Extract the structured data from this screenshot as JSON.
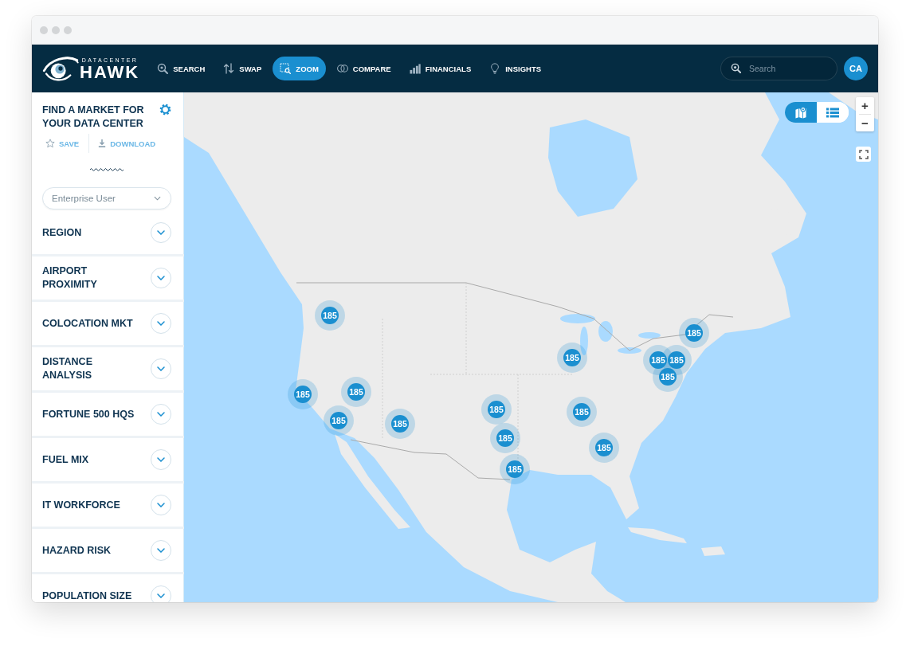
{
  "header": {
    "logo": {
      "line_1": "DATACENTER",
      "line_2": "HAWK"
    },
    "nav": [
      {
        "kind": "search",
        "label": "SEARCH",
        "selected": false
      },
      {
        "kind": "swap",
        "label": "SWAP",
        "selected": false
      },
      {
        "kind": "zoom",
        "label": "ZOOM",
        "selected": true
      },
      {
        "kind": "compare",
        "label": "COMPARE",
        "selected": false
      },
      {
        "kind": "financials",
        "label": "FINANCIALS",
        "selected": false
      },
      {
        "kind": "insights",
        "label": "INSIGHTS",
        "selected": false
      }
    ],
    "search": {
      "placeholder": "Search"
    },
    "avatar": {
      "initials": "CA"
    }
  },
  "sidebar": {
    "title": "FIND A MARKET FOR YOUR DATA CENTER",
    "actions": [
      {
        "kind": "save",
        "label": "SAVE"
      },
      {
        "kind": "download",
        "label": "DOWNLOAD"
      }
    ],
    "user_type": {
      "value": "Enterprise User"
    },
    "filters": [
      {
        "label": "REGION",
        "expanded": false
      },
      {
        "label": "AIRPORT PROXIMITY",
        "expanded": false
      },
      {
        "label": "COLOCATION MKT",
        "expanded": false
      },
      {
        "label": "DISTANCE ANALYSIS",
        "expanded": false
      },
      {
        "label": "FORTUNE 500 HQS",
        "expanded": false
      },
      {
        "label": "FUEL MIX",
        "expanded": false
      },
      {
        "label": "IT WORKFORCE",
        "expanded": false
      },
      {
        "label": "HAZARD RISK",
        "expanded": false
      },
      {
        "label": "POPULATION SIZE",
        "expanded": false
      }
    ]
  },
  "map": {
    "view_toggle": [
      {
        "kind": "map",
        "selected": true
      },
      {
        "kind": "list",
        "selected": false
      }
    ],
    "zoom_controls": [
      "+",
      "−"
    ],
    "clusters": [
      {
        "count": "185"
      },
      {
        "count": "185"
      },
      {
        "count": "185"
      },
      {
        "count": "185"
      },
      {
        "count": "185"
      },
      {
        "count": "185"
      },
      {
        "count": "185"
      },
      {
        "count": "185"
      },
      {
        "count": "185"
      },
      {
        "count": "185"
      },
      {
        "count": "185"
      },
      {
        "count": "185"
      },
      {
        "count": "185"
      },
      {
        "count": "185"
      },
      {
        "count": "185"
      }
    ]
  }
}
